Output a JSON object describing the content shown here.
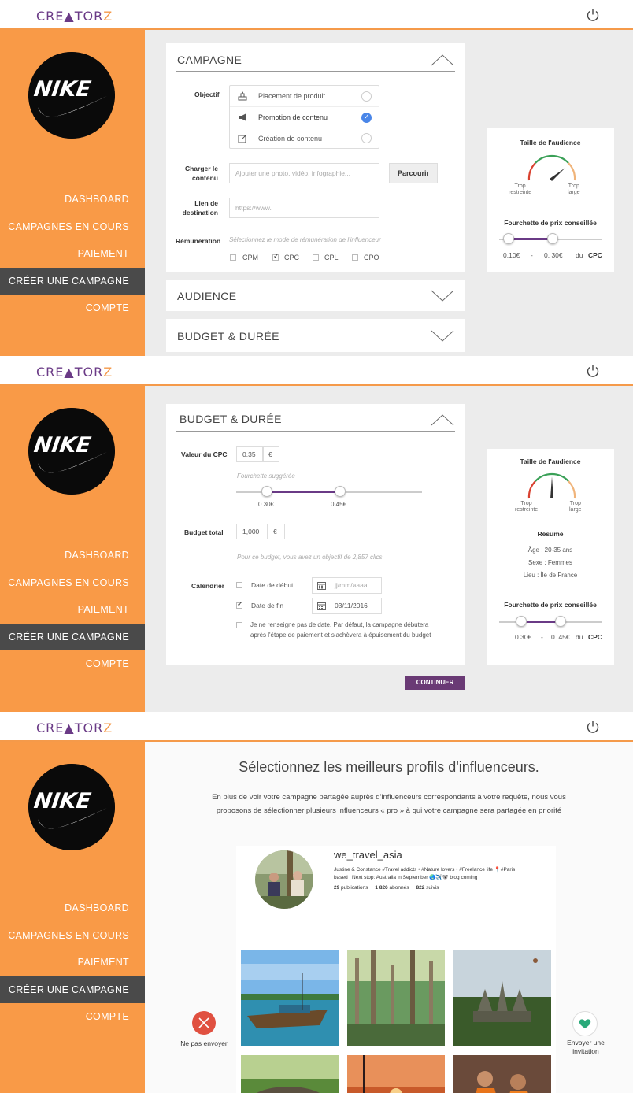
{
  "brand": {
    "logo": "CREATORZ",
    "accent": "#f99a47",
    "purple": "#6a3a86",
    "nav_active": "#4a4a4a"
  },
  "nav": [
    "DASHBOARD",
    "CAMPAGNES EN COURS",
    "PAIEMENT",
    "CRÉER UNE CAMPAGNE",
    "COMPTE"
  ],
  "screen1": {
    "campagne": {
      "title": "CAMPAGNE",
      "objectif_label": "Objectif",
      "objectives": [
        {
          "label": "Placement de produit",
          "icon": "podium-icon",
          "selected": false
        },
        {
          "label": "Promotion de contenu",
          "icon": "megaphone-icon",
          "selected": true
        },
        {
          "label": "Création de contenu",
          "icon": "edit-icon",
          "selected": false
        }
      ],
      "charger_label_1": "Charger le",
      "charger_label_2": "contenu",
      "charger_placeholder": "Ajouter une photo, vidéo, infographie...",
      "browse_button": "Parcourir",
      "lien_label_1": "Lien de",
      "lien_label_2": "destination",
      "lien_placeholder": "https://www.",
      "remuneration_label": "Rémunération",
      "remuneration_hint": "Sélectionnez le mode de rémunération de l'influenceur",
      "modes": [
        {
          "label": "CPM",
          "checked": false
        },
        {
          "label": "CPC",
          "checked": true
        },
        {
          "label": "CPL",
          "checked": false
        },
        {
          "label": "CPO",
          "checked": false
        }
      ]
    },
    "audience_title": "AUDIENCE",
    "budget_title": "BUDGET & DURÉE",
    "side": {
      "audience_title": "Taille de l'audience",
      "gauge_left_1": "Trop",
      "gauge_left_2": "restreinte",
      "gauge_right_1": "Trop",
      "gauge_right_2": "large",
      "price_title": "Fourchette de prix conseillée",
      "price_low": "0.10€",
      "dash": "-",
      "price_high": "0. 30€",
      "du": "du",
      "unit": "CPC"
    }
  },
  "screen2": {
    "title": "BUDGET & DURÉE",
    "cpc_label": "Valeur du CPC",
    "cpc_value": "0.35",
    "currency": "€",
    "suggested": "Fourchette suggérée",
    "range_low": "0.30€",
    "range_high": "0.45€",
    "budget_label": "Budget total",
    "budget_value": "1,000",
    "objective_text": "Pour ce budget, vous avez un objectif de 2,857 clics",
    "calendar_label": "Calendrier",
    "start_label": "Date de début",
    "start_placeholder": "jj/mm/aaaa",
    "end_label": "Date de fin",
    "end_value": "03/11/2016",
    "no_date_1": "Je ne renseigne pas de date. Par défaut, la campagne débutera",
    "no_date_2": "après l'étape de paiement et s'achèvera à épuisement du budget",
    "continue_button": "CONTINUER",
    "side": {
      "audience_title": "Taille de l'audience",
      "gauge_left_1": "Trop",
      "gauge_left_2": "restreinte",
      "gauge_right_1": "Trop",
      "gauge_right_2": "large",
      "resume_title": "Résumé",
      "age": "Âge : 20-35 ans",
      "sexe": "Sexe : Femmes",
      "lieu": "Lieu : Île de France",
      "price_title": "Fourchette de prix conseillée",
      "price_low": "0.30€",
      "dash": "-",
      "price_high": "0. 45€",
      "du": "du",
      "unit": "CPC"
    }
  },
  "screen3": {
    "heading": "Sélectionnez les meilleurs profils d'influenceurs.",
    "intro_1": "En plus de voir votre campagne partagée auprès d'influenceurs correspondants à votre requête, nous vous",
    "intro_2": "proposons de sélectionner plusieurs influenceurs « pro » à qui votre campagne sera partagée en priorité",
    "profile": {
      "username": "we_travel_asia",
      "bio_1": "Justine & Constance #Travel addicts • #Nature lovers • #Freelance life 📍#Paris",
      "bio_2": "based | Next stop: Australia in September 🌏✈️🐨 blog coming",
      "posts_n": "29",
      "posts_l": "publications",
      "followers_n": "1 826",
      "followers_l": "abonnés",
      "following_n": "822",
      "following_l": "suivis"
    },
    "reject_label": "Ne pas envoyer",
    "accept_label_1": "Envoyer une",
    "accept_label_2": "invitation"
  }
}
